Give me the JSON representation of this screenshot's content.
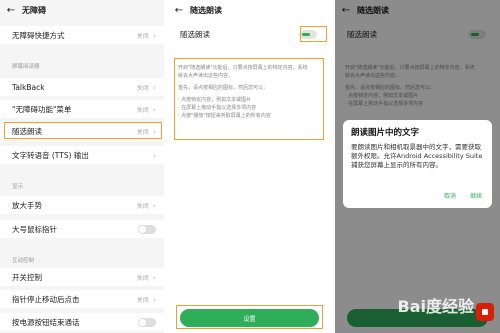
{
  "panel1": {
    "title": "无障碍",
    "rows": [
      {
        "label": "无障碍快捷方式",
        "value": "关闭"
      },
      {
        "label": "TalkBack",
        "value": "关闭"
      },
      {
        "label": "\"无障碍功能\"菜单",
        "value": "关闭"
      },
      {
        "label": "随选朗读",
        "value": "关闭"
      },
      {
        "label": "文字转语音 (TTS) 输出",
        "value": ""
      },
      {
        "label": "放大手势",
        "value": "关闭"
      },
      {
        "label": "大号鼠标指针",
        "value": ""
      },
      {
        "label": "开关控制",
        "value": "关闭"
      },
      {
        "label": "指针停止移动后点击",
        "value": "关闭"
      },
      {
        "label": "按电源按钮结束通话",
        "value": ""
      }
    ],
    "sections": [
      "屏幕阅读器",
      "显示",
      "互动控制"
    ]
  },
  "panel2": {
    "title": "随选朗读",
    "switch_label": "随选朗读",
    "desc_lines": [
      "开启\"随选朗读\"功能后，只要点按屏幕上的特定内容，系统",
      "就会大声读出这些内容。",
      "",
      "首先，请点按相应的图标，然后您可以：",
      "",
      "· 点按特定内容，例如文本或图片",
      "· 在屏幕上拖动手指以选择多项内容",
      "· 点按\"播放\"按钮来听取屏幕上的所有内容"
    ],
    "settings_button": "设置"
  },
  "panel3": {
    "title": "随选朗读",
    "switch_label": "随选朗读",
    "desc_lines": [
      "开启\"随选朗读\"功能后，只要点按屏幕上的特定内容，系统",
      "就会大声读出这些内容。",
      "",
      "首先，请点按相应的图标，然后您可以：",
      "· 点按特定内容，例如文本或图片",
      "· 在屏幕上拖动手指以选择多项内容"
    ],
    "dialog": {
      "title": "朗读图片中的文字",
      "body": "要朗读图片和相机取景器中的文字，需要获取额外权限。允许Android Accessibility Suite捕获您屏幕上显示的所有内容。",
      "cancel": "取消",
      "continue": "继续"
    },
    "watermark": "Bai度经验"
  },
  "colors": {
    "accent": "#2fae5a",
    "highlight": "#f0a030"
  }
}
